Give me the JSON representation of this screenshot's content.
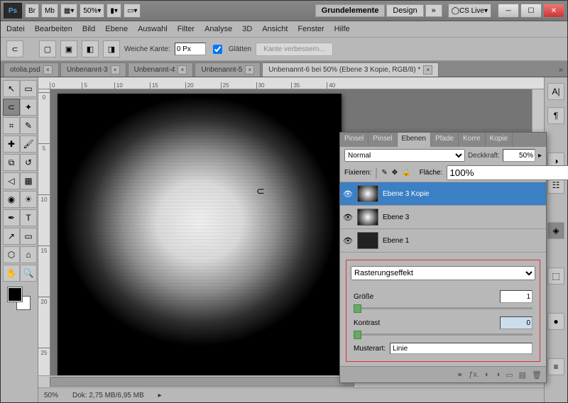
{
  "titlebar": {
    "ps": "Ps",
    "br": "Br",
    "mb": "Mb",
    "zoom": "50%",
    "workspace_active": "Grundelemente",
    "workspace2": "Design",
    "more": "»",
    "cslive": "CS Live"
  },
  "menu": {
    "datei": "Datei",
    "bearbeiten": "Bearbeiten",
    "bild": "Bild",
    "ebene": "Ebene",
    "auswahl": "Auswahl",
    "filter": "Filter",
    "analyse": "Analyse",
    "threed": "3D",
    "ansicht": "Ansicht",
    "fenster": "Fenster",
    "hilfe": "Hilfe"
  },
  "options": {
    "weiche_kante": "Weiche Kante:",
    "px_value": "0 Px",
    "glatten": "Glätten",
    "kante_verbessern": "Kante verbessern..."
  },
  "tabs": {
    "t1": "otolia.psd",
    "t2": "Unbenannt-3",
    "t3": "Unbenannt-4",
    "t4": "Unbenannt-5",
    "t5": "Unbenannt-6 bei 50% (Ebene 3 Kopie, RGB/8) *",
    "more": "»"
  },
  "ruler": {
    "h": [
      "0",
      "5",
      "10",
      "15",
      "20",
      "25",
      "30",
      "35",
      "40"
    ],
    "v": [
      "0",
      "5",
      "10",
      "15",
      "20",
      "25"
    ]
  },
  "status": {
    "zoom": "50%",
    "doc": "Dok: 2,75 MB/6,95 MB"
  },
  "panel": {
    "tabs": {
      "pinsel": "Pinsel",
      "pinsel2": "Pinsel",
      "ebenen": "Ebenen",
      "pfade": "Pfade",
      "korre": "Korre",
      "kopie": "Kopie"
    },
    "blend": "Normal",
    "deckkraft_label": "Deckkraft:",
    "deckkraft": "50%",
    "fixieren": "Fixieren:",
    "flache_label": "Fläche:",
    "flache": "100%",
    "layers": [
      {
        "name": "Ebene 3 Kopie"
      },
      {
        "name": "Ebene 3"
      },
      {
        "name": "Ebene 1"
      }
    ],
    "effect": "Rasterungseffekt",
    "groesse": "Größe",
    "groesse_val": "1",
    "kontrast": "Kontrast",
    "kontrast_val": "0",
    "musterart": "Musterart:",
    "muster_val": "Linie"
  }
}
